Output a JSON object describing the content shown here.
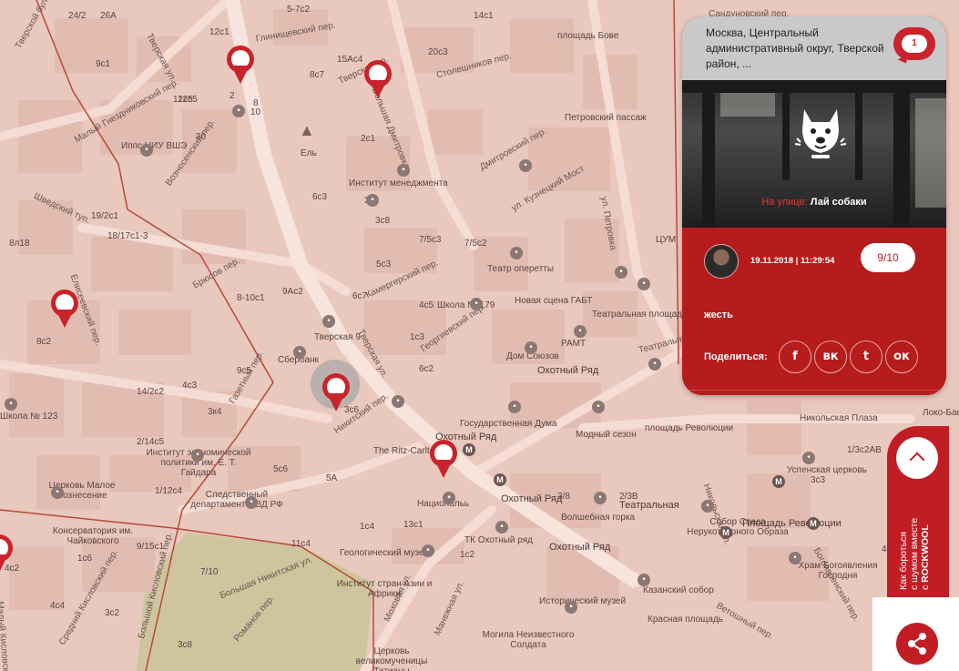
{
  "map": {
    "labels": [
      {
        "text": "Тверской бульв.",
        "cls": "street"
      },
      {
        "text": "Тверская ул.",
        "cls": "street"
      },
      {
        "text": "Тверская ул.",
        "cls": "street"
      },
      {
        "text": "Глинищевский пер.",
        "cls": "street"
      },
      {
        "text": "Тверской пр.",
        "cls": "street"
      },
      {
        "text": "ул. Большая Дмитровка",
        "cls": "street"
      },
      {
        "text": "Столешников пер.",
        "cls": "street"
      },
      {
        "text": "площадь Бове",
        "cls": ""
      },
      {
        "text": "Сандуновский пер.",
        "cls": "street"
      },
      {
        "text": "Петровский пассаж",
        "cls": ""
      },
      {
        "text": "Малый Гнездниковский пер.",
        "cls": "street"
      },
      {
        "text": "Иппс НИУ ВШЭ",
        "cls": ""
      },
      {
        "text": "Ель",
        "cls": ""
      },
      {
        "text": "Институт менеджмента",
        "cls": ""
      },
      {
        "text": "Дмитровский пер.",
        "cls": "street"
      },
      {
        "text": "ул. Кузнецкий Мост",
        "cls": "street"
      },
      {
        "text": "ул. Петровка",
        "cls": "street"
      },
      {
        "text": "Шведский туп.",
        "cls": "street"
      },
      {
        "text": "Вознесенский пер.",
        "cls": "street"
      },
      {
        "text": "ЦУМ",
        "cls": ""
      },
      {
        "text": "Камергерский пер.",
        "cls": "street"
      },
      {
        "text": "Театр оперетты",
        "cls": ""
      },
      {
        "text": "Елисеевский пер.",
        "cls": "street"
      },
      {
        "text": "Брюсов пер.",
        "cls": "street"
      },
      {
        "text": "Школа № 179",
        "cls": ""
      },
      {
        "text": "Новая сцена ГАБТ",
        "cls": ""
      },
      {
        "text": "Театральная площадь",
        "cls": ""
      },
      {
        "text": "Тверская 9",
        "cls": ""
      },
      {
        "text": "Сбербанк",
        "cls": ""
      },
      {
        "text": "Георгиевский пер.",
        "cls": "street"
      },
      {
        "text": "Дом Союзов",
        "cls": ""
      },
      {
        "text": "РАМТ",
        "cls": ""
      },
      {
        "text": "Охотный Ряд",
        "cls": "big"
      },
      {
        "text": "Театральный пр.",
        "cls": "street"
      },
      {
        "text": "Газетный пер.",
        "cls": "street"
      },
      {
        "text": "Никитский пер.",
        "cls": "street"
      },
      {
        "text": "Государственная Дума",
        "cls": ""
      },
      {
        "text": "Модный сезон",
        "cls": ""
      },
      {
        "text": "площадь Революции",
        "cls": ""
      },
      {
        "text": "Никольская Плаза",
        "cls": ""
      },
      {
        "text": "Локо-Банк",
        "cls": ""
      },
      {
        "text": "Школа № 123",
        "cls": ""
      },
      {
        "text": "Институт экономической политики им. Е. Т. Гайдара",
        "cls": ""
      },
      {
        "text": "The Ritz-Carlton",
        "cls": ""
      },
      {
        "text": "Охотный Ряд",
        "cls": "big"
      },
      {
        "text": "Церковь Малое Вознесение",
        "cls": ""
      },
      {
        "text": "Следственный департамент МВД РФ",
        "cls": ""
      },
      {
        "text": "Национальь",
        "cls": ""
      },
      {
        "text": "Охотный Ряд",
        "cls": "big"
      },
      {
        "text": "Театральная",
        "cls": "big"
      },
      {
        "text": "Успенская церковь",
        "cls": ""
      },
      {
        "text": "Консерватория им. Чайковского",
        "cls": ""
      },
      {
        "text": "Волшебная горка",
        "cls": ""
      },
      {
        "text": "Собор Спаса Нерукотворного Образа",
        "cls": ""
      },
      {
        "text": "Площадь Революции",
        "cls": "big"
      },
      {
        "text": "ТК Охотный ряд",
        "cls": ""
      },
      {
        "text": "Охотный Ряд",
        "cls": "big"
      },
      {
        "text": "Геологический музей",
        "cls": ""
      },
      {
        "text": "Храм Богоявления Господня",
        "cls": ""
      },
      {
        "text": "Моховая ул.",
        "cls": "street"
      },
      {
        "text": "Манежная ул.",
        "cls": "street"
      },
      {
        "text": "Большая Никитская ул.",
        "cls": "street"
      },
      {
        "text": "Институт стран Азии и Африки",
        "cls": ""
      },
      {
        "text": "Казанский собор",
        "cls": ""
      },
      {
        "text": "Исторический музей",
        "cls": ""
      },
      {
        "text": "Красная площадь",
        "cls": ""
      },
      {
        "text": "Романов пер.",
        "cls": "street"
      },
      {
        "text": "Могила Неизвестного Солдата",
        "cls": ""
      },
      {
        "text": "Церковь великомученицы Татианы",
        "cls": ""
      },
      {
        "text": "Ветошный пер.",
        "cls": "street"
      },
      {
        "text": "Никольская ул.",
        "cls": "street"
      },
      {
        "text": "Богоявленский пер.",
        "cls": "street"
      },
      {
        "text": "Большой Кисловский пер.",
        "cls": "street"
      },
      {
        "text": "Малый Кисловский пер.",
        "cls": "street"
      },
      {
        "text": "Средний Кисловский пер.",
        "cls": "street"
      }
    ],
    "house_numbers": [
      "24/2",
      "26А",
      "5-7с2",
      "12с1",
      "12с5",
      "10",
      "2",
      "8с7",
      "15Ас4",
      "20с3",
      "14с1",
      "9с1",
      "12с5",
      "26",
      "8",
      "2с1",
      "6с3",
      "3с6",
      "7/5с3",
      "3с8",
      "7/5с2",
      "5с3",
      "4с5",
      "8-10с1",
      "9Ас2",
      "6с7",
      "1с3",
      "6с2",
      "19/2с1",
      "18/17с1-3",
      "8л18",
      "8с2",
      "14/2с2",
      "4с3",
      "9с5",
      "3с6",
      "3к4",
      "2/14с5",
      "5с6",
      "5А",
      "1/12с4",
      "13с1",
      "1с4",
      "11с4",
      "1с2",
      "3/8",
      "4с2",
      "2/3В",
      "7/10",
      "4с4",
      "3с2",
      "3с8",
      "9/15с1",
      "1с6",
      "1/3с2АВ",
      "4с11",
      "3с3"
    ]
  },
  "card": {
    "address": "Москва, Центральный административный округ, Тверской район, ...",
    "comment_count": "1",
    "photo_category": "На улице:",
    "photo_title": "Лай собаки",
    "date": "19.11.2018 | 11:29:54",
    "score": "9/10",
    "comment": "жесть",
    "share_label": "Поделиться:",
    "social": [
      {
        "name": "facebook",
        "glyph": "f"
      },
      {
        "name": "vk",
        "glyph": "вк"
      },
      {
        "name": "twitter",
        "glyph": "t"
      },
      {
        "name": "odnoklassniki",
        "glyph": "ок"
      }
    ]
  },
  "promo": {
    "line1": "Как бороться",
    "line2": "с шумом вместе",
    "line3_prefix": "с",
    "brand": "ROCKWOOL"
  },
  "colors": {
    "map_base": "#e9c8bd",
    "map_green": "#cbc49a",
    "accent": "#c9232b",
    "card_body": "#b71c1c",
    "header_gray": "#c9c9c9"
  }
}
